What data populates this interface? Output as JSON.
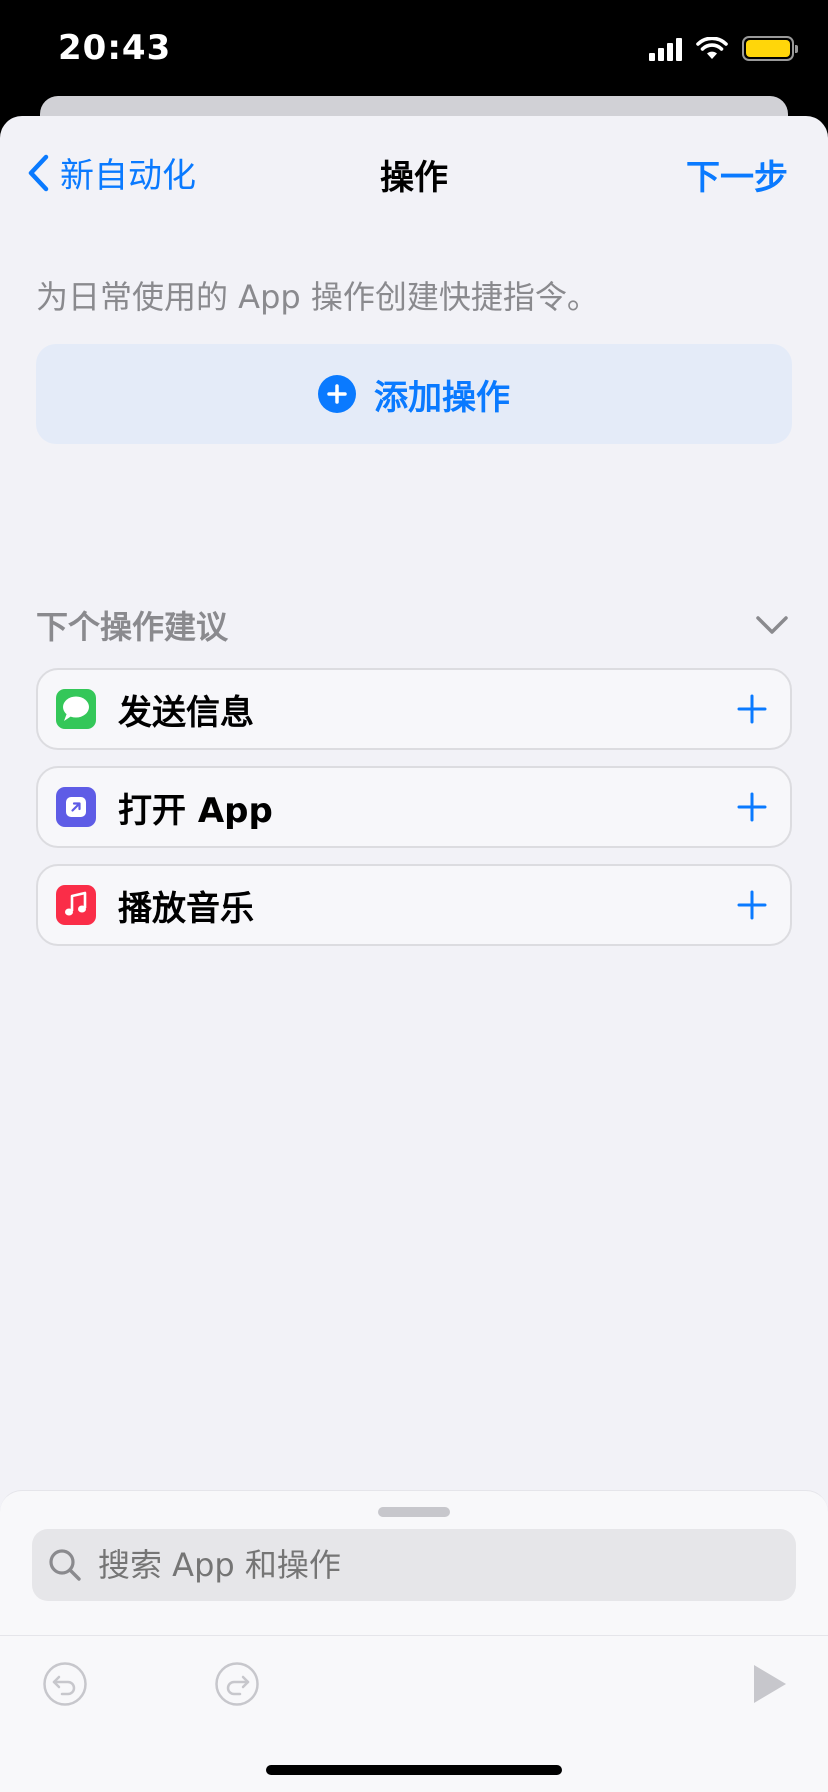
{
  "status_bar": {
    "time": "20:43",
    "icons": [
      "cellular-signal-icon",
      "wifi-icon",
      "battery-icon"
    ],
    "battery_color": "#ffd60a"
  },
  "nav": {
    "back_label": "新自动化",
    "title": "操作",
    "next_label": "下一步"
  },
  "description": "为日常使用的 App 操作创建快捷指令。",
  "add_action": {
    "label": "添加操作",
    "icon": "plus-circle-icon"
  },
  "suggestions": {
    "header": "下个操作建议",
    "items": [
      {
        "label": "发送信息",
        "icon": "messages-icon",
        "color": "#34c759"
      },
      {
        "label": "打开 App",
        "icon": "open-app-icon",
        "color": "#5e5ce6"
      },
      {
        "label": "播放音乐",
        "icon": "music-note-icon",
        "color": "#fa2d48"
      }
    ]
  },
  "search": {
    "placeholder": "搜索 App 和操作"
  },
  "toolbar": {
    "icons": [
      "undo-icon",
      "redo-icon",
      "play-icon"
    ]
  },
  "colors": {
    "accent": "#0a7aff",
    "background": "#f2f2f7"
  }
}
